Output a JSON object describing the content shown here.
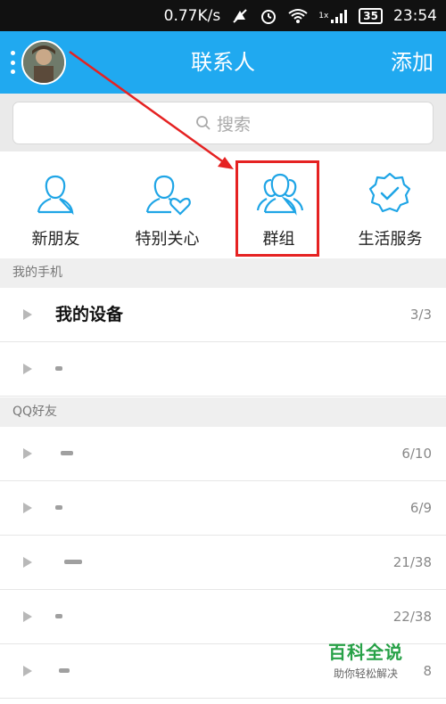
{
  "status_bar": {
    "speed": "0.77K/s",
    "network": "1x",
    "battery": "35",
    "time": "23:54"
  },
  "header": {
    "title": "联系人",
    "add_label": "添加"
  },
  "search": {
    "placeholder": "搜索"
  },
  "quick_actions": [
    {
      "label": "新朋友",
      "icon": "person-icon"
    },
    {
      "label": "特别关心",
      "icon": "person-heart-icon"
    },
    {
      "label": "群组",
      "icon": "group-icon"
    },
    {
      "label": "生活服务",
      "icon": "badge-check-icon"
    }
  ],
  "sections": [
    {
      "title": "我的手机",
      "rows": [
        {
          "label": "我的设备",
          "count": "3/3"
        },
        {
          "label": "",
          "count": ""
        }
      ]
    },
    {
      "title": "QQ好友",
      "rows": [
        {
          "label": "",
          "count": "6/10"
        },
        {
          "label": "",
          "count": "6/9"
        },
        {
          "label": "",
          "count": "21/38"
        },
        {
          "label": "",
          "count": "22/38"
        },
        {
          "label": "",
          "count": "8"
        }
      ]
    }
  ],
  "watermark": {
    "main": "百科全说",
    "sub": "助你轻松解决"
  },
  "colors": {
    "header_bg": "#20a9f0",
    "icon_stroke": "#1fa5e6",
    "highlight": "#e52222",
    "watermark": "#27a147"
  }
}
